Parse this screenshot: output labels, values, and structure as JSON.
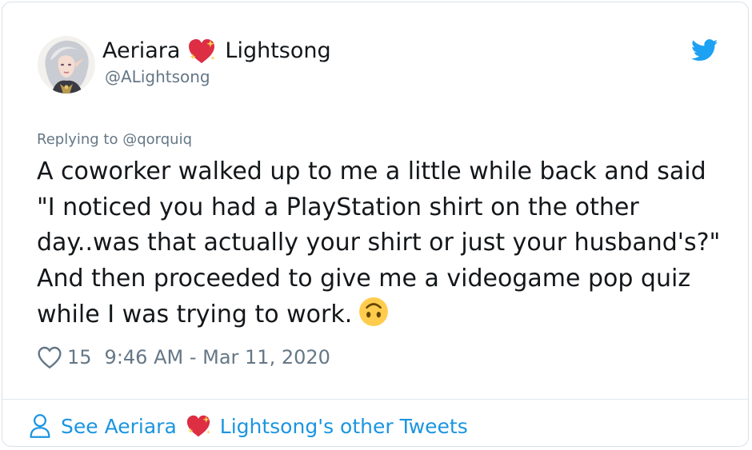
{
  "author": {
    "name_first": "Aeriara",
    "name_last": "Lightsong",
    "handle": "@ALightsong",
    "avatar_icon": "avatar-illustration",
    "name_emoji": "sparkling-heart-icon"
  },
  "tweet": {
    "replying_prefix": "Replying to",
    "replying_to": "@qorquiq",
    "text": "A coworker walked up to me a little while back and said \"I noticed you had a PlayStation shirt on the other day..was that actually your shirt or just your husband's?\" And then proceeded to give me a videogame pop quiz while I was trying to work.",
    "trailing_emoji": "upside-down-face-icon",
    "likes": "15",
    "timestamp": "9:46 AM - Mar 11, 2020"
  },
  "footer": {
    "prefix": "See Aeriara",
    "suffix": "Lightsong's other Tweets"
  },
  "colors": {
    "brand_blue": "#1da1f2",
    "link_blue": "#1b95e0",
    "secondary_text": "#657786",
    "primary_text": "#14171a",
    "heart_pink": "#e0245e"
  }
}
